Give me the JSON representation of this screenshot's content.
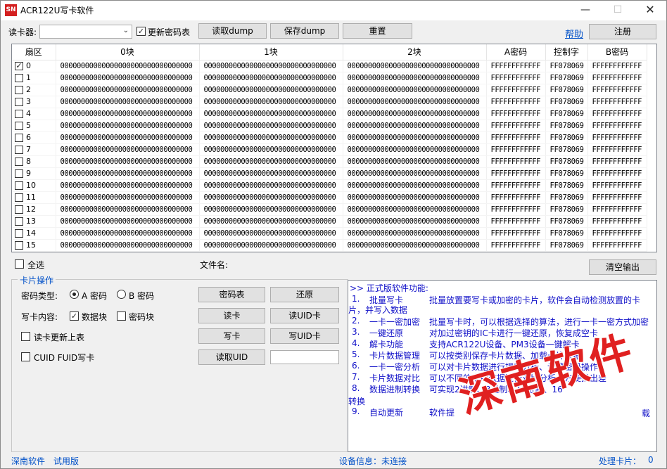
{
  "window": {
    "title": "ACR122U写卡软件",
    "icon_text": "SN"
  },
  "toolbar": {
    "reader_label": "读卡器:",
    "reader_value": "",
    "update_pwd_label": "更新密码表",
    "update_pwd_checked": true,
    "read_dump": "读取dump",
    "save_dump": "保存dump",
    "reset": "重置",
    "help": "帮助",
    "register": "注册"
  },
  "grid": {
    "columns": [
      "扇区",
      "0块",
      "1块",
      "2块",
      "A密码",
      "控制字",
      "B密码"
    ],
    "block_value": "00000000000000000000000000000000",
    "rows": [
      {
        "sector": "0",
        "checked": true,
        "b0": "00000000000000000000000000000000",
        "b1": "00000000000000000000000000000000",
        "b2": "00000000000000000000000000000000",
        "a": "FFFFFFFFFFFF",
        "ctl": "FF078069",
        "b": "FFFFFFFFFFFF"
      },
      {
        "sector": "1",
        "checked": false,
        "b0": "00000000000000000000000000000000",
        "b1": "00000000000000000000000000000000",
        "b2": "00000000000000000000000000000000",
        "a": "FFFFFFFFFFFF",
        "ctl": "FF078069",
        "b": "FFFFFFFFFFFF"
      },
      {
        "sector": "2",
        "checked": false,
        "b0": "00000000000000000000000000000000",
        "b1": "00000000000000000000000000000000",
        "b2": "00000000000000000000000000000000",
        "a": "FFFFFFFFFFFF",
        "ctl": "FF078069",
        "b": "FFFFFFFFFFFF"
      },
      {
        "sector": "3",
        "checked": false,
        "b0": "00000000000000000000000000000000",
        "b1": "00000000000000000000000000000000",
        "b2": "00000000000000000000000000000000",
        "a": "FFFFFFFFFFFF",
        "ctl": "FF078069",
        "b": "FFFFFFFFFFFF"
      },
      {
        "sector": "4",
        "checked": false,
        "b0": "00000000000000000000000000000000",
        "b1": "00000000000000000000000000000000",
        "b2": "00000000000000000000000000000000",
        "a": "FFFFFFFFFFFF",
        "ctl": "FF078069",
        "b": "FFFFFFFFFFFF"
      },
      {
        "sector": "5",
        "checked": false,
        "b0": "00000000000000000000000000000000",
        "b1": "00000000000000000000000000000000",
        "b2": "00000000000000000000000000000000",
        "a": "FFFFFFFFFFFF",
        "ctl": "FF078069",
        "b": "FFFFFFFFFFFF"
      },
      {
        "sector": "6",
        "checked": false,
        "b0": "00000000000000000000000000000000",
        "b1": "00000000000000000000000000000000",
        "b2": "00000000000000000000000000000000",
        "a": "FFFFFFFFFFFF",
        "ctl": "FF078069",
        "b": "FFFFFFFFFFFF"
      },
      {
        "sector": "7",
        "checked": false,
        "b0": "00000000000000000000000000000000",
        "b1": "00000000000000000000000000000000",
        "b2": "00000000000000000000000000000000",
        "a": "FFFFFFFFFFFF",
        "ctl": "FF078069",
        "b": "FFFFFFFFFFFF"
      },
      {
        "sector": "8",
        "checked": false,
        "b0": "00000000000000000000000000000000",
        "b1": "00000000000000000000000000000000",
        "b2": "00000000000000000000000000000000",
        "a": "FFFFFFFFFFFF",
        "ctl": "FF078069",
        "b": "FFFFFFFFFFFF"
      },
      {
        "sector": "9",
        "checked": false,
        "b0": "00000000000000000000000000000000",
        "b1": "00000000000000000000000000000000",
        "b2": "00000000000000000000000000000000",
        "a": "FFFFFFFFFFFF",
        "ctl": "FF078069",
        "b": "FFFFFFFFFFFF"
      },
      {
        "sector": "10",
        "checked": false,
        "b0": "00000000000000000000000000000000",
        "b1": "00000000000000000000000000000000",
        "b2": "00000000000000000000000000000000",
        "a": "FFFFFFFFFFFF",
        "ctl": "FF078069",
        "b": "FFFFFFFFFFFF"
      },
      {
        "sector": "11",
        "checked": false,
        "b0": "00000000000000000000000000000000",
        "b1": "00000000000000000000000000000000",
        "b2": "00000000000000000000000000000000",
        "a": "FFFFFFFFFFFF",
        "ctl": "FF078069",
        "b": "FFFFFFFFFFFF"
      },
      {
        "sector": "12",
        "checked": false,
        "b0": "00000000000000000000000000000000",
        "b1": "00000000000000000000000000000000",
        "b2": "00000000000000000000000000000000",
        "a": "FFFFFFFFFFFF",
        "ctl": "FF078069",
        "b": "FFFFFFFFFFFF"
      },
      {
        "sector": "13",
        "checked": false,
        "b0": "00000000000000000000000000000000",
        "b1": "00000000000000000000000000000000",
        "b2": "00000000000000000000000000000000",
        "a": "FFFFFFFFFFFF",
        "ctl": "FF078069",
        "b": "FFFFFFFFFFFF"
      },
      {
        "sector": "14",
        "checked": false,
        "b0": "00000000000000000000000000000000",
        "b1": "00000000000000000000000000000000",
        "b2": "00000000000000000000000000000000",
        "a": "FFFFFFFFFFFF",
        "ctl": "FF078069",
        "b": "FFFFFFFFFFFF"
      },
      {
        "sector": "15",
        "checked": false,
        "b0": "00000000000000000000000000000000",
        "b1": "00000000000000000000000000000000",
        "b2": "00000000000000000000000000000000",
        "a": "FFFFFFFFFFFF",
        "ctl": "FF078069",
        "b": "FFFFFFFFFFFF"
      }
    ]
  },
  "below_grid": {
    "select_all": "全选",
    "select_all_checked": false,
    "filename_label": "文件名:",
    "clear_output": "清空输出"
  },
  "card_ops": {
    "title": "卡片操作",
    "pwd_type_label": "密码类型:",
    "pwd_a": "A 密码",
    "pwd_a_selected": true,
    "pwd_b": "B 密码",
    "pwd_b_selected": false,
    "write_content_label": "写卡内容:",
    "data_block": "数据块",
    "data_block_checked": true,
    "pwd_block": "密码块",
    "pwd_block_checked": false,
    "read_update_table": "读卡更新上表",
    "read_update_checked": false,
    "cuid_fuid": "CUID FUID写卡",
    "cuid_fuid_checked": false,
    "pwd_table_btn": "密码表",
    "restore_btn": "还原",
    "read_card_btn": "读卡",
    "read_uid_card_btn": "读UID卡",
    "write_card_btn": "写卡",
    "write_uid_card_btn": "写UID卡",
    "read_uid_btn": "读取UID",
    "uid_value": ""
  },
  "output": {
    "header": ">> 正式版软件功能:",
    "items": [
      {
        "n": "1.",
        "title": "批量写卡",
        "desc": "批量放置要写卡或加密的卡片，软件会自动检测放置的卡"
      },
      {
        "n": "",
        "title": "",
        "desc": ""
      },
      {
        "n": "2.",
        "title": "一卡一密加密",
        "desc": "批量写卡时，可以根据选择的算法，进行一卡一密方式加密"
      },
      {
        "n": "3.",
        "title": "一键还原",
        "desc": "对加过密钥的IC卡进行一键还原，恢复成空卡"
      },
      {
        "n": "4.",
        "title": "解卡功能",
        "desc": "支持ACR122U设备、PM3设备一键解卡"
      },
      {
        "n": "5.",
        "title": "卡片数据管理",
        "desc": "可以按类别保存卡片数据、加载卡片数据"
      },
      {
        "n": "6.",
        "title": "一卡一密分析",
        "desc": "可以对卡片数据进行提交分析、计算密码操作"
      },
      {
        "n": "7.",
        "title": "卡片数据对比",
        "desc": "可以不同的卡片数据进行对比分析，方便找出差"
      },
      {
        "n": "8.",
        "title": "数据进制转换",
        "desc": "可实现2进制、8进制、10进制、16"
      },
      {
        "n": "",
        "title": "",
        "desc": ""
      },
      {
        "n": "9.",
        "title": "自动更新",
        "desc": "软件提"
      }
    ],
    "wrap_1": "片，并写入数据",
    "wrap_8": "转换",
    "tail_9": "载"
  },
  "watermark": "深南软件",
  "statusbar": {
    "company": "深南软件",
    "edition": "试用版",
    "device_info": "设备信息：未连接",
    "processed_label": "处理卡片：",
    "processed_count": "0"
  }
}
